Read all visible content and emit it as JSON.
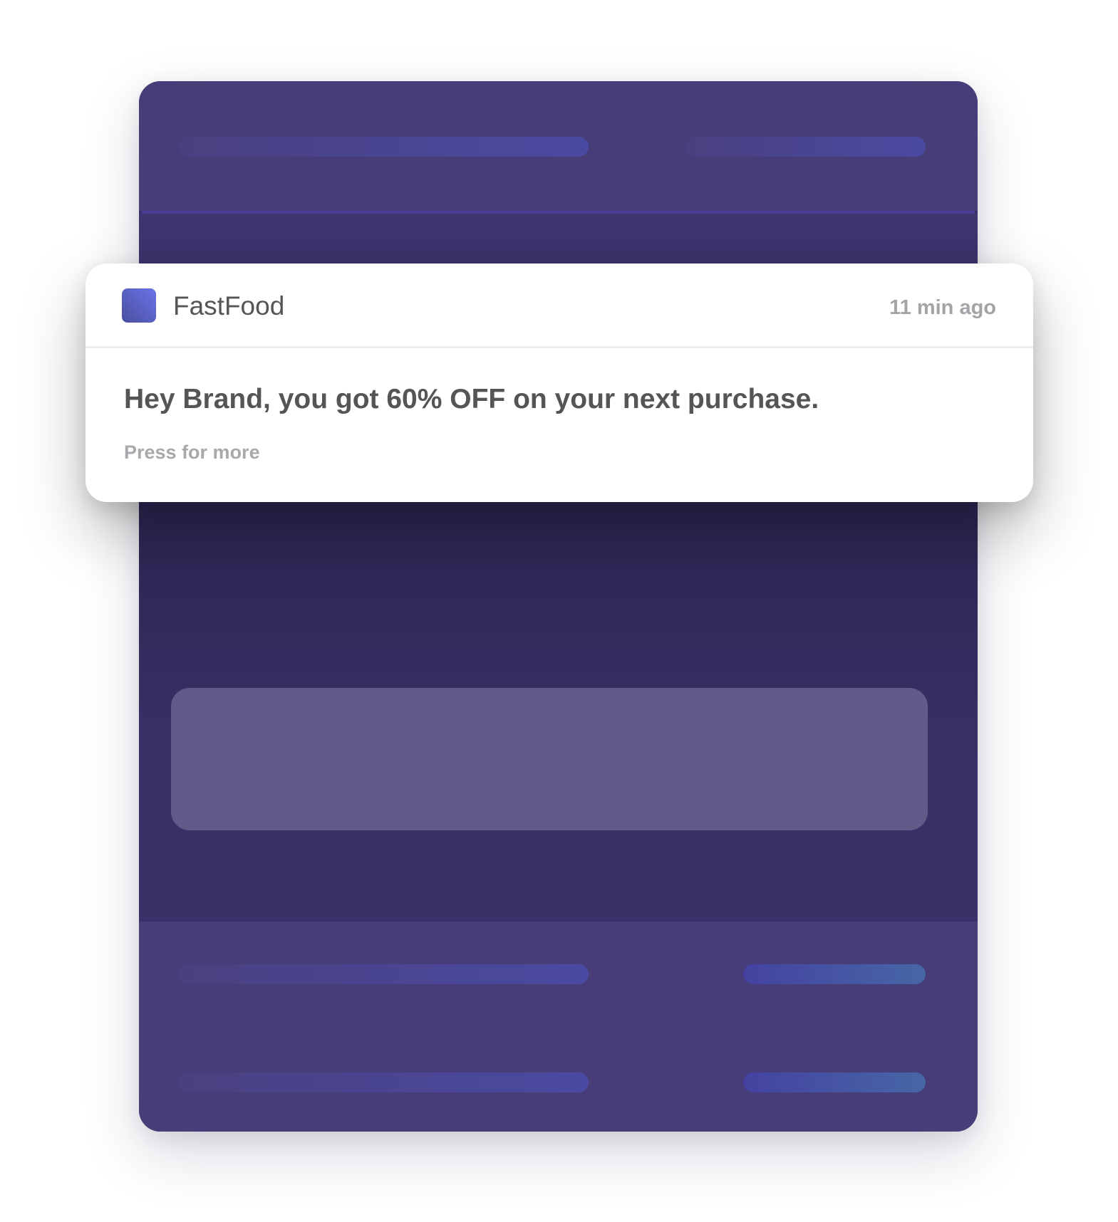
{
  "notification": {
    "app_name": "FastFood",
    "timestamp": "11 min ago",
    "title": "Hey Brand, you got 60% OFF on your next purchase.",
    "subtitle": "Press for more",
    "icon": "app-logo-icon"
  },
  "colors": {
    "card_background": "#3b3168",
    "card_header": "#473d79",
    "placeholder_bar": "#4b4aa2",
    "accent_bar": "#4766a6",
    "content_block": "#625a88",
    "app_icon": "#6b73e8",
    "notification_text": "#555555",
    "muted_text": "#a3a3a8"
  }
}
